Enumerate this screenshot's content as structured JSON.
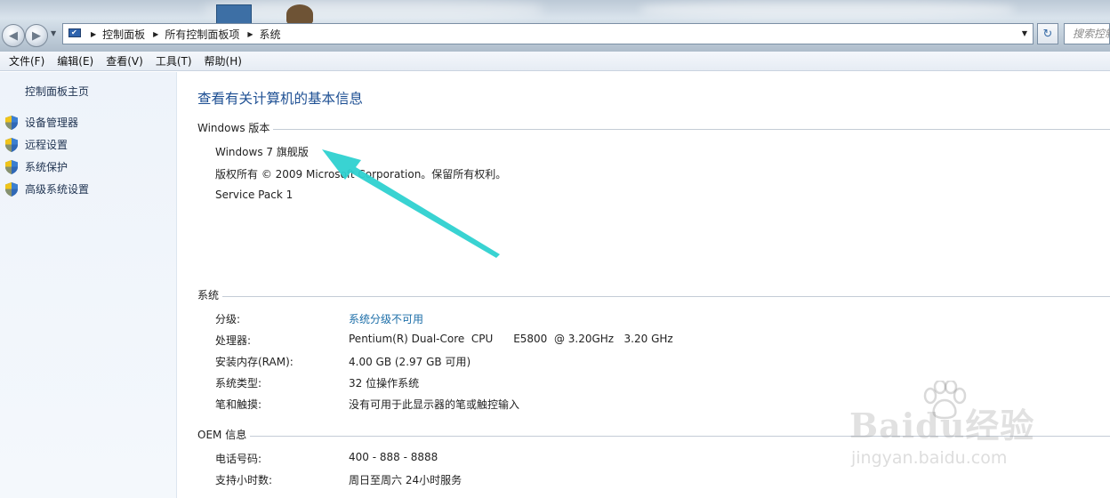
{
  "addressbar": {
    "crumbs": [
      "控制面板",
      "所有控制面板项",
      "系统"
    ]
  },
  "search": {
    "placeholder": "搜索控制面板"
  },
  "menu": {
    "items": [
      "文件(F)",
      "编辑(E)",
      "查看(V)",
      "工具(T)",
      "帮助(H)"
    ]
  },
  "sidebar": {
    "home": "控制面板主页",
    "tasks": [
      {
        "label": "设备管理器",
        "icon": "shield-icon"
      },
      {
        "label": "远程设置",
        "icon": "shield-icon"
      },
      {
        "label": "系统保护",
        "icon": "shield-icon"
      },
      {
        "label": "高级系统设置",
        "icon": "shield-icon"
      }
    ]
  },
  "main": {
    "title": "查看有关计算机的基本信息",
    "windows_edition": {
      "heading": "Windows 版本",
      "edition": "Windows 7 旗舰版",
      "copyright": "版权所有 © 2009 Microsoft Corporation。保留所有权利。",
      "service_pack": "Service Pack 1"
    },
    "system": {
      "heading": "系统",
      "rows": [
        {
          "label": "分级:",
          "value": "系统分级不可用",
          "link": true
        },
        {
          "label": "处理器:",
          "value": "Pentium(R) Dual-Core  CPU      E5800  @ 3.20GHz   3.20 GHz"
        },
        {
          "label": "安装内存(RAM):",
          "value": "4.00 GB (2.97 GB 可用)"
        },
        {
          "label": "系统类型:",
          "value": "32 位操作系统"
        },
        {
          "label": "笔和触摸:",
          "value": "没有可用于此显示器的笔或触控输入"
        }
      ]
    },
    "oem": {
      "heading": "OEM 信息",
      "rows": [
        {
          "label": "电话号码:",
          "value": "400 - 888 - 8888"
        },
        {
          "label": "支持小时数:",
          "value": "周日至周六  24小时服务"
        }
      ]
    }
  },
  "watermark": {
    "brand": "Baidu经验",
    "url": "jingyan.baidu.com"
  },
  "colors": {
    "accent": "#1d4f93",
    "link": "#1c6ea8",
    "arrow": "#2ed1d0"
  }
}
